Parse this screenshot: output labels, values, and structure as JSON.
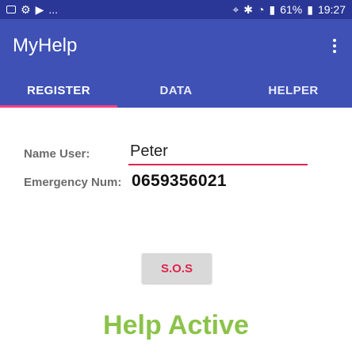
{
  "status_bar": {
    "left_icons": [
      "image-icon",
      "settings-icon",
      "play-store-icon"
    ],
    "overflow": "...",
    "signal": "61%",
    "time": "19:27"
  },
  "app_bar": {
    "title": "MyHelp"
  },
  "tabs": [
    {
      "label": "REGISTER",
      "active": true
    },
    {
      "label": "DATA",
      "active": false
    },
    {
      "label": "HELPER",
      "active": false
    }
  ],
  "form": {
    "name_label": "Name User:",
    "name_value": "Peter",
    "emergency_label": "Emergency Num:",
    "emergency_value": "0659356021"
  },
  "sos_button": {
    "label": "S.O.S"
  },
  "help_status": {
    "text": "Help Active",
    "color": "#8bc34a"
  },
  "colors": {
    "primary": "#3f51b5",
    "primary_dark": "#2a3796",
    "accent": "#ff4081",
    "error_red": "#e0244c"
  }
}
